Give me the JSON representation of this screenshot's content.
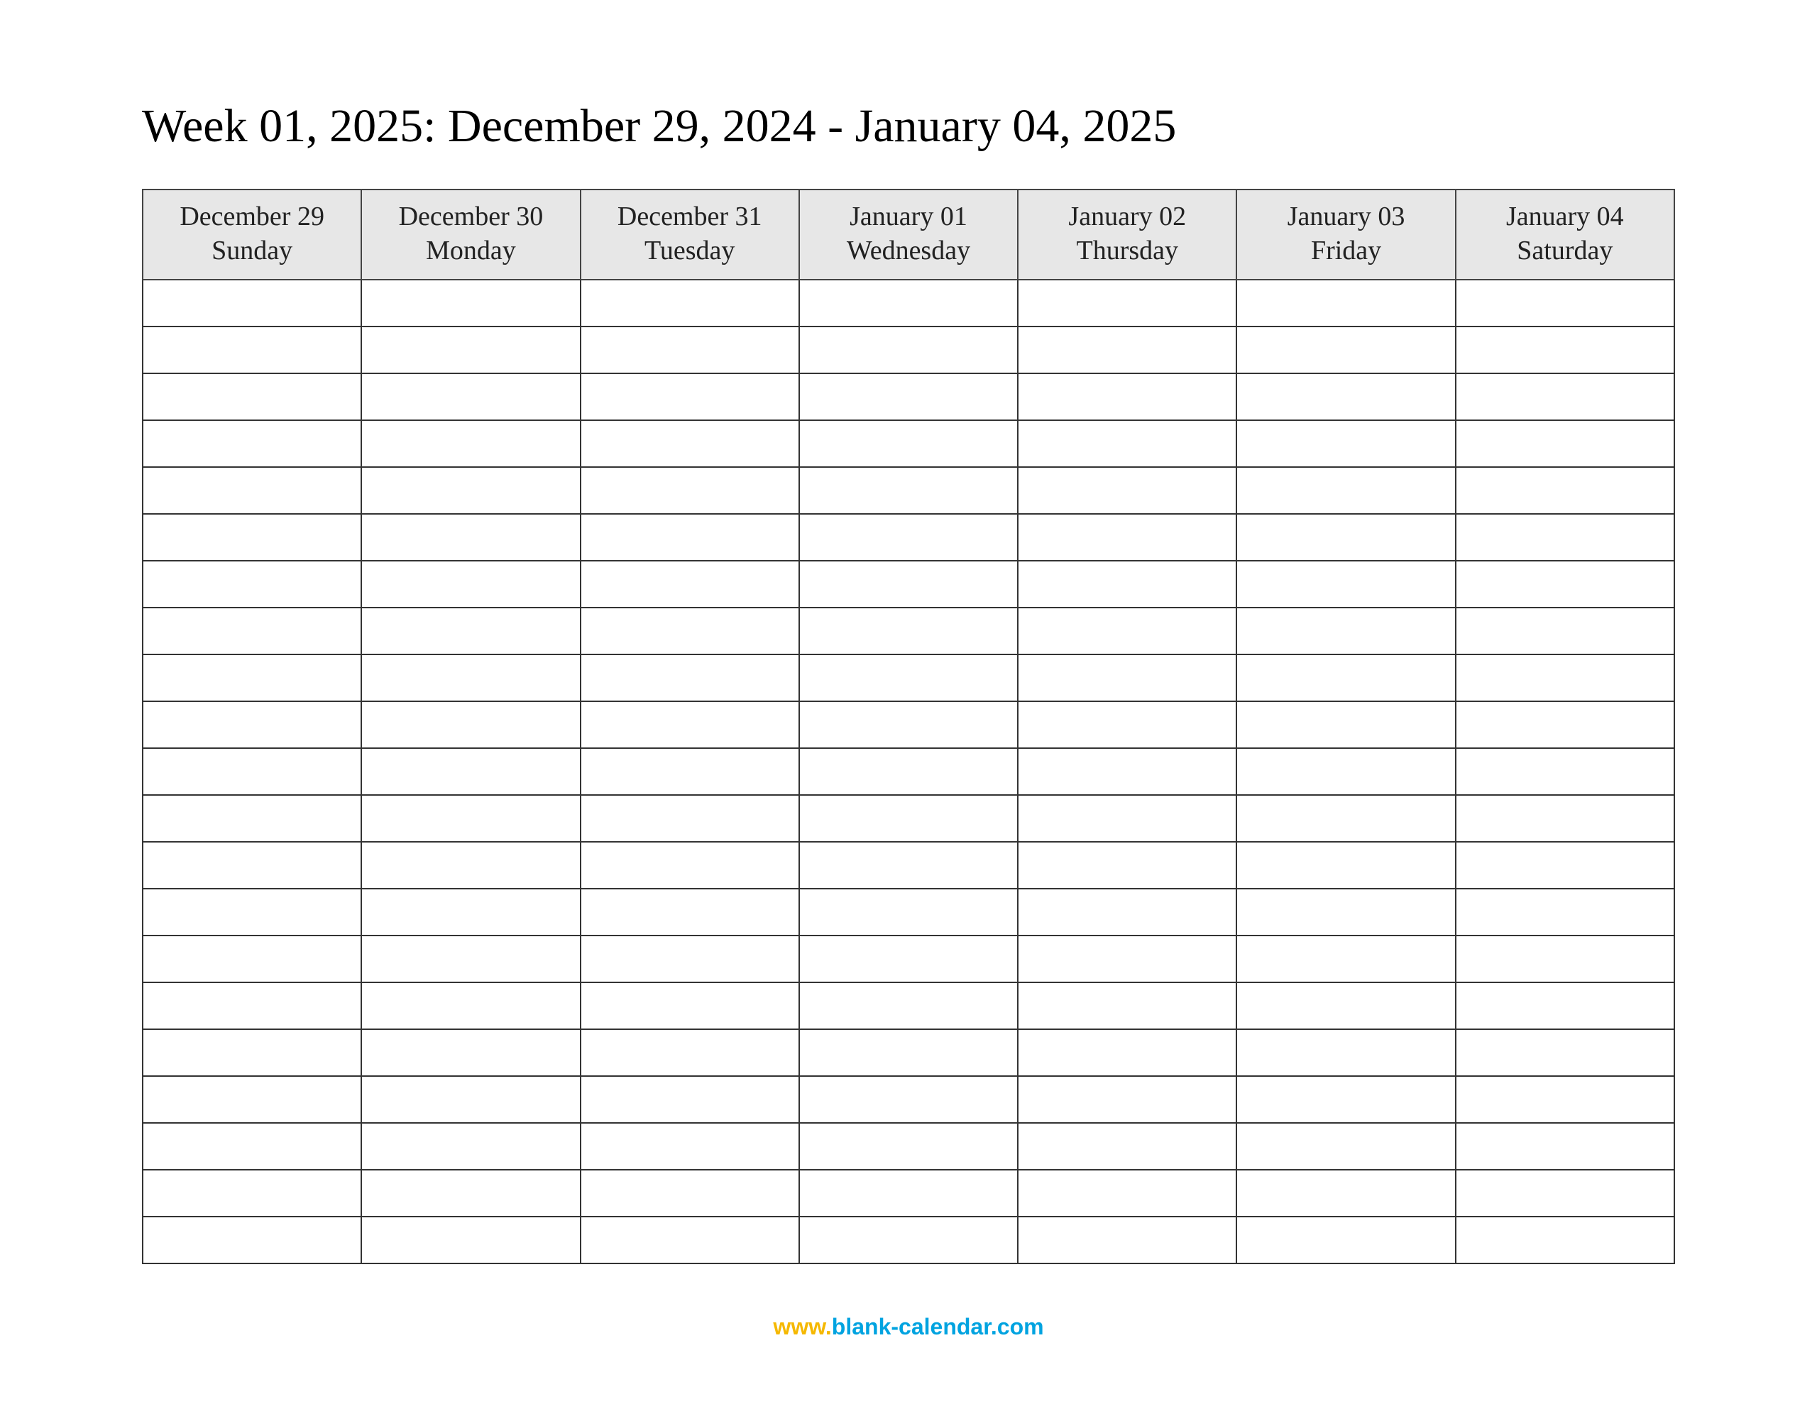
{
  "title": "Week 01, 2025: December 29, 2024 - January 04, 2025",
  "columns": [
    {
      "date": "December 29",
      "day": "Sunday"
    },
    {
      "date": "December 30",
      "day": "Monday"
    },
    {
      "date": "December 31",
      "day": "Tuesday"
    },
    {
      "date": "January 01",
      "day": "Wednesday"
    },
    {
      "date": "January 02",
      "day": "Thursday"
    },
    {
      "date": "January 03",
      "day": "Friday"
    },
    {
      "date": "January 04",
      "day": "Saturday"
    }
  ],
  "row_count": 21,
  "footer": {
    "www": "www.",
    "domain": "blank-calendar.com"
  }
}
